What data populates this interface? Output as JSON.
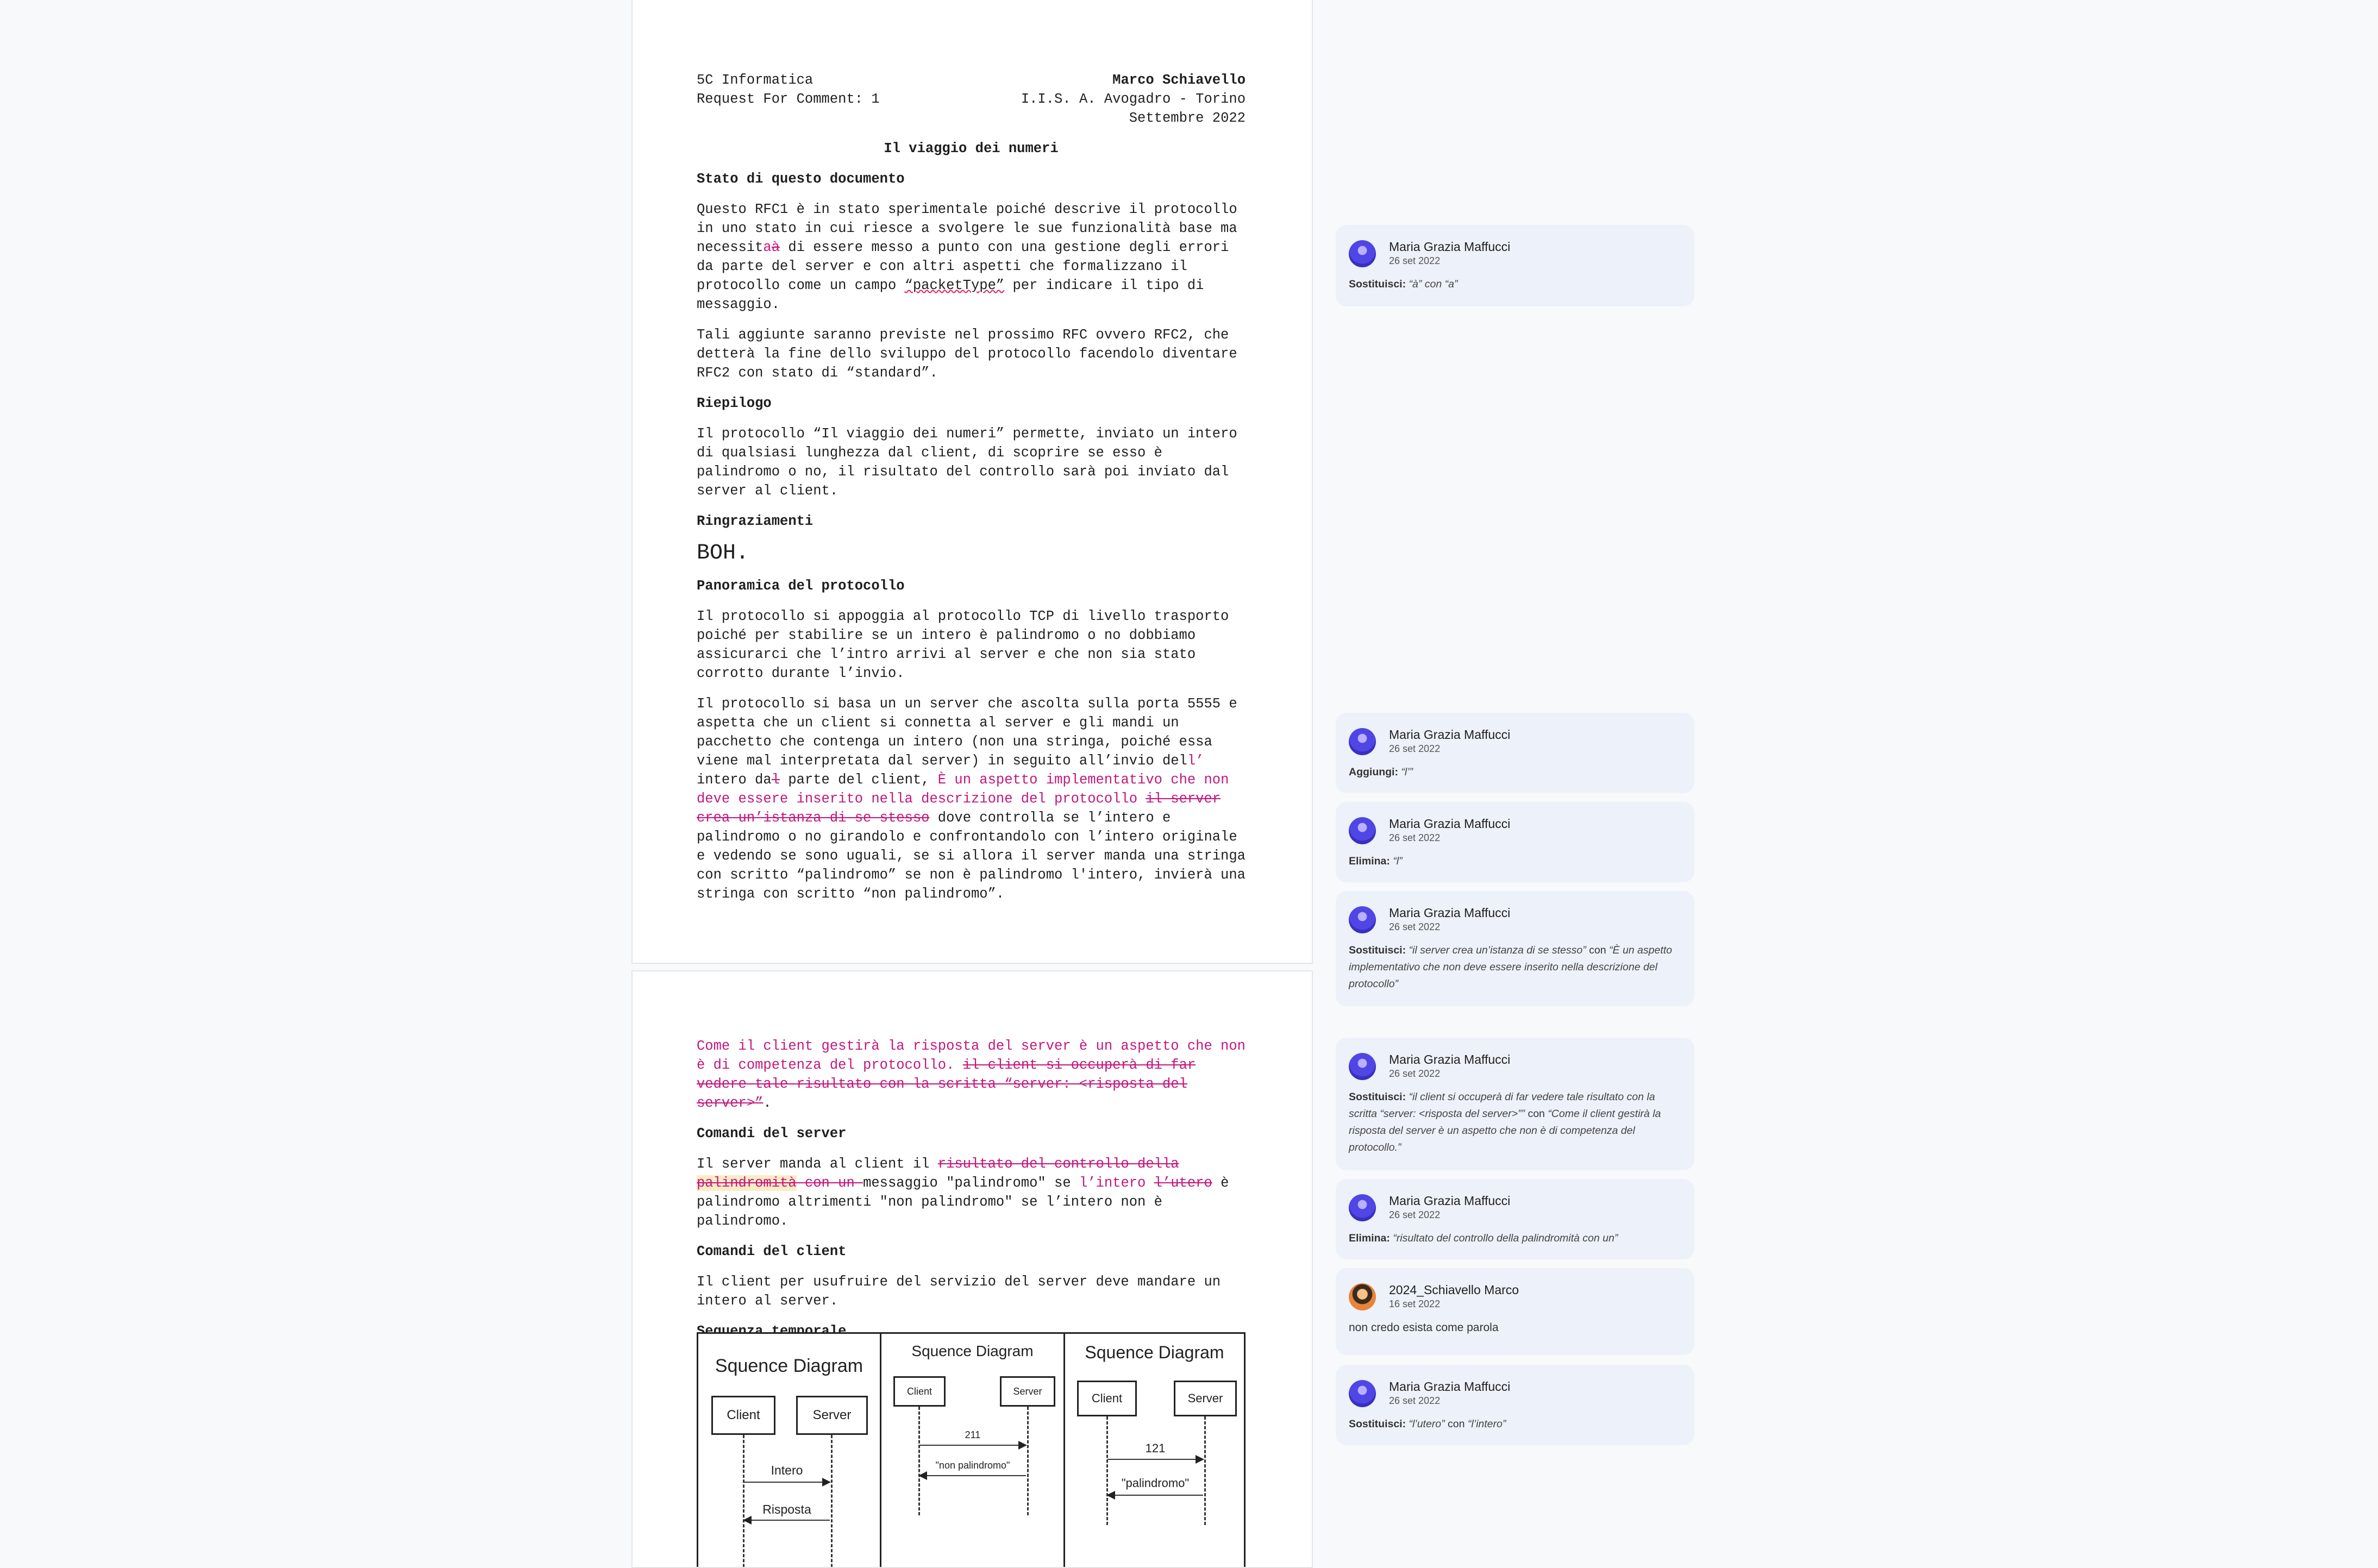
{
  "header": {
    "left1": "5C Informatica",
    "left2": "Request For Comment: 1",
    "right1": "Marco Schiavello",
    "right2": "I.I.S. A. Avogadro - Torino",
    "right3": "Settembre 2022"
  },
  "doc_title": "Il viaggio dei numeri",
  "s1": {
    "heading": "Stato di questo documento",
    "p1_a": "Questo RFC1 è in stato sperimentale poiché descrive il protocollo in uno stato in cui riesce a svolgere le sue funzionalità base ma necessit",
    "p1_ins": "a",
    "p1_del": "à",
    "p1_b": " di essere messo a punto con una gestione degli errori da parte del server e con altri aspetti che formalizzano il protocollo come un campo ",
    "p1_term": "“packetType”",
    "p1_c": " per indicare il tipo di messaggio.",
    "p2": "Tali aggiunte saranno previste nel prossimo RFC ovvero RFC2, che detterà la fine dello sviluppo del protocollo facendolo diventare RFC2 con stato di “standard”."
  },
  "s2": {
    "heading": "Riepilogo",
    "p1": "Il protocollo “Il viaggio dei numeri” permette, inviato un intero di qualsiasi lunghezza dal client, di scoprire se esso è palindromo o no, il risultato del controllo sarà poi inviato dal server al client."
  },
  "s3": {
    "heading": "Ringraziamenti",
    "big": "BOH."
  },
  "s4": {
    "heading": "Panoramica del protocollo",
    "p1": "Il protocollo si appoggia al protocollo TCP di livello trasporto poiché per stabilire se un intero è palindromo o no dobbiamo assicurarci che l’intro arrivi al server e che non sia stato corrotto durante l’invio.",
    "p2_a": "Il protocollo si basa un un server che ascolta sulla porta 5555 e aspetta che un client si connetta al server e gli mandi un pacchetto che contenga un intero (non una stringa, poiché essa viene mal interpretata dal server) in seguito all’invio del",
    "p2_ins1": "l’",
    "p2_b": " intero da",
    "p2_del1": "l",
    "p2_c": " parte del client, ",
    "p2_ins2": "È un aspetto implementativo che non deve essere inserito nella descrizione del protocollo",
    "p2_d": " ",
    "p2_del2": "il server crea un’istanza di se stesso",
    "p2_e": " dove controlla se l’intero e palindromo o no girandolo e confrontandolo con l’intero originale e vedendo se sono uguali, se si allora il server manda una stringa con scritto “palindromo” se non è palindromo l'intero, invierà una stringa con scritto “non palindromo”."
  },
  "page2": {
    "p0_ins": "Come il client gestirà la risposta del server è un aspetto che non è di competenza del protocollo.",
    "p0_sp": " ",
    "p0_del": "il client si occuperà di far vedere tale risultato con la scritta “server: <risposta del server>”",
    "p0_end": ".",
    "h1": "Comandi del server",
    "p1_a": "Il server manda al client il ",
    "p1_del1": "risultato del controllo della ",
    "p1_del1_hl": "palindromità",
    "p1_del1b": " con un ",
    "p1_b": "messaggio \"palindromo\" se ",
    "p1_ins": "l’intero",
    "p1_sp": " ",
    "p1_del2": "l’utero",
    "p1_c": " è palindromo altrimenti \"non palindromo\" se l’intero non è palindromo.",
    "h2": "Comandi del client",
    "p2": "Il client per usufruire del servizio del server deve mandare un intero al server.",
    "h3": "Sequenza temporale"
  },
  "diagram": {
    "panels": [
      {
        "title": "Squence Diagram",
        "client": "Client",
        "server": "Server",
        "msg1": "Intero",
        "msg2": "Risposta"
      },
      {
        "title": "Squence Diagram",
        "client": "Client",
        "server": "Server",
        "msg1": "211",
        "msg2": "\"non palindromo\""
      },
      {
        "title": "Squence Diagram",
        "client": "Client",
        "server": "Server",
        "msg1": "121",
        "msg2": "\"palindromo\""
      }
    ]
  },
  "comments": [
    {
      "author": "Maria Grazia Maffucci",
      "date": "26 set 2022",
      "label": "Sostituisci:",
      "text": "“à” con “a”"
    },
    {
      "author": "Maria Grazia Maffucci",
      "date": "26 set 2022",
      "label": "Aggiungi:",
      "text": "“l’”"
    },
    {
      "author": "Maria Grazia Maffucci",
      "date": "26 set 2022",
      "label": "Elimina:",
      "text": "“l”"
    },
    {
      "author": "Maria Grazia Maffucci",
      "date": "26 set 2022",
      "label": "Sostituisci:",
      "text": "“il server crea un’istanza di se stesso”",
      "mid": " con ",
      "text2": "“È un aspetto implementativo che non deve essere inserito nella descrizione del protocollo”"
    },
    {
      "author": "Maria Grazia Maffucci",
      "date": "26 set 2022",
      "label": "Sostituisci:",
      "text": "“il client si occuperà di far vedere tale risultato con la scritta “server: <risposta del server>”” ",
      "mid": "con ",
      "text2": "“Come il client gestirà la risposta del server è un aspetto che non è di competenza del protocollo.”"
    },
    {
      "author": "Maria Grazia Maffucci",
      "date": "26 set 2022",
      "label": "Elimina:",
      "text": "“risultato del controllo della palindromità con un”"
    },
    {
      "author": "2024_Schiavello Marco",
      "date": "16 set 2022",
      "plain": "non credo esista come parola"
    },
    {
      "author": "Maria Grazia Maffucci",
      "date": "26 set 2022",
      "label": "Sostituisci:",
      "text": "“l’utero”",
      "mid": " con ",
      "text2": "“l’intero”"
    }
  ]
}
